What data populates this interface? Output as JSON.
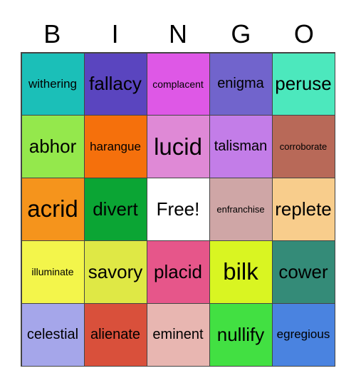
{
  "header": {
    "letters": [
      "B",
      "I",
      "N",
      "G",
      "O"
    ]
  },
  "cells": [
    {
      "word": "withering",
      "color": "#1bbfb8",
      "size": "s-s"
    },
    {
      "word": "fallacy",
      "color": "#5a45bf",
      "size": "s-l"
    },
    {
      "word": "complacent",
      "color": "#de58e6",
      "size": "s-xs"
    },
    {
      "word": "enigma",
      "color": "#7164cc",
      "size": "s-m"
    },
    {
      "word": "peruse",
      "color": "#4ce8bd",
      "size": "s-l"
    },
    {
      "word": "abhor",
      "color": "#94e84c",
      "size": "s-l"
    },
    {
      "word": "harangue",
      "color": "#f5700c",
      "size": "s-s"
    },
    {
      "word": "lucid",
      "color": "#df89d6",
      "size": "s-xl"
    },
    {
      "word": "talisman",
      "color": "#c37de8",
      "size": "s-m"
    },
    {
      "word": "corroborate",
      "color": "#b86958",
      "size": "s-xxs"
    },
    {
      "word": "acrid",
      "color": "#f5941c",
      "size": "s-xl"
    },
    {
      "word": "divert",
      "color": "#0ba534",
      "size": "s-l"
    },
    {
      "word": "Free!",
      "color": "#ffffff",
      "size": "s-l"
    },
    {
      "word": "enfranchise",
      "color": "#cfa6a6",
      "size": "s-xxs"
    },
    {
      "word": "replete",
      "color": "#f8cd8c",
      "size": "s-l"
    },
    {
      "word": "illuminate",
      "color": "#f3f54b",
      "size": "s-xs"
    },
    {
      "word": "savory",
      "color": "#dfe845",
      "size": "s-l"
    },
    {
      "word": "placid",
      "color": "#e6568a",
      "size": "s-l"
    },
    {
      "word": "bilk",
      "color": "#d9f522",
      "size": "s-xl"
    },
    {
      "word": "cower",
      "color": "#348b78",
      "size": "s-l"
    },
    {
      "word": "celestial",
      "color": "#a5a6ea",
      "size": "s-m"
    },
    {
      "word": "alienate",
      "color": "#d9503b",
      "size": "s-m"
    },
    {
      "word": "eminent",
      "color": "#e8b6b1",
      "size": "s-m"
    },
    {
      "word": "nullify",
      "color": "#42e042",
      "size": "s-l"
    },
    {
      "word": "egregious",
      "color": "#4a83e0",
      "size": "s-s"
    }
  ]
}
